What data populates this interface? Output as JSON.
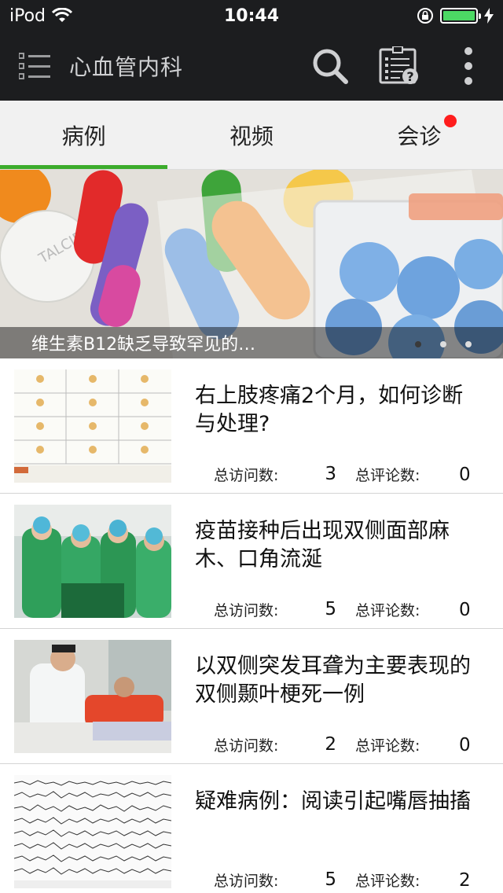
{
  "status_bar": {
    "carrier": "iPod",
    "time": "10:44",
    "battery_level": 1.0,
    "battery_color": "#4cd964"
  },
  "header": {
    "title": "心血管内科",
    "icons": [
      "menu-icon",
      "search-icon",
      "checklist-help-icon",
      "more-vertical-icon"
    ],
    "background": "#1c1d1f"
  },
  "tabs": [
    {
      "label": "病例",
      "active": true
    },
    {
      "label": "视频",
      "active": false
    },
    {
      "label": "会诊",
      "active": false,
      "badge": true
    }
  ],
  "tab_accent_color": "#3cac2c",
  "banner": {
    "caption": "维生素B12缺乏导致罕见的…",
    "dots": 3,
    "active_dot": 0
  },
  "meta_labels": {
    "visits": "总访问数:",
    "comments": "总评论数:"
  },
  "cases": [
    {
      "title": "右上肢疼痛2个月，如何诊断与处理?",
      "visits": "3",
      "comments": "0",
      "thumb": "figure-grid"
    },
    {
      "title": "疫苗接种后出现双侧面部麻木、口角流涎",
      "visits": "5",
      "comments": "0",
      "thumb": "surgeons-photo"
    },
    {
      "title": "以双侧突发耳聋为主要表现的双侧颞叶梗死一例",
      "visits": "2",
      "comments": "0",
      "thumb": "doctor-patient-photo"
    },
    {
      "title": "疑难病例：阅读引起嘴唇抽搐",
      "visits": "5",
      "comments": "2",
      "thumb": "eeg-chart"
    }
  ]
}
